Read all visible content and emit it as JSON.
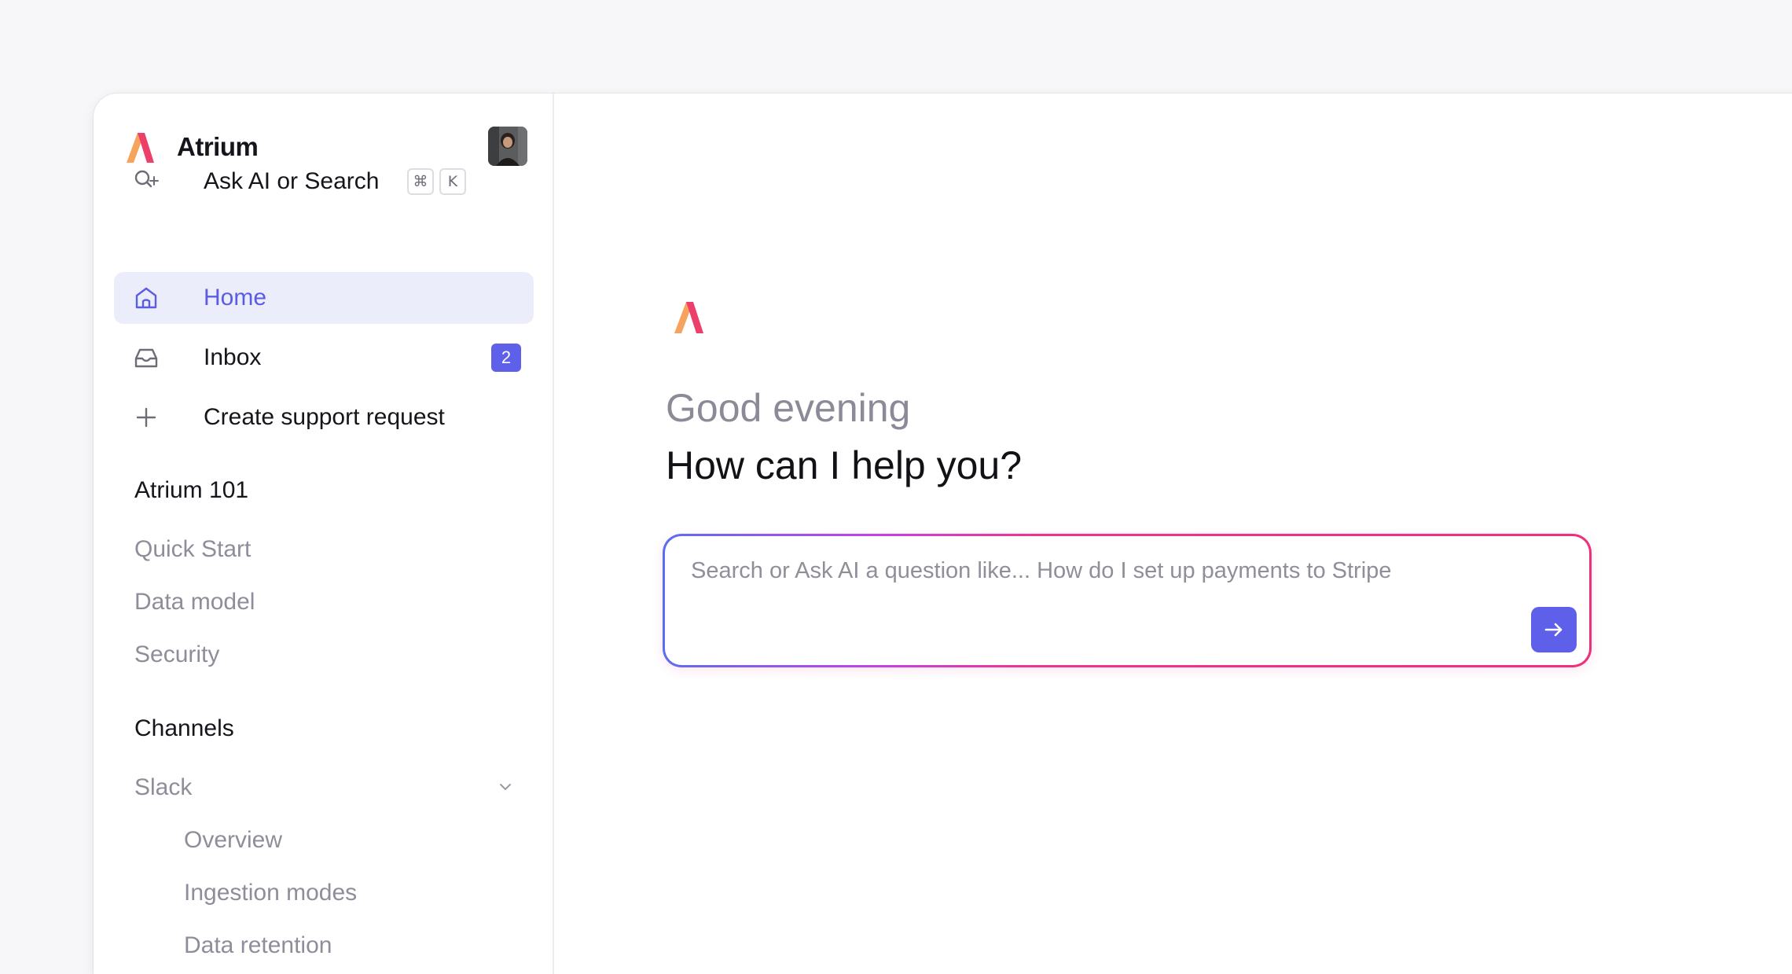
{
  "brand": {
    "name": "Atrium",
    "logo_colors": [
      "#f6a45d",
      "#ec3f6a"
    ]
  },
  "colors": {
    "accent": "#5e60ea",
    "active_bg": "#ecedfb",
    "gradient": [
      "#5b6ef0",
      "#c043e8",
      "#f0338f",
      "#ee2f7c"
    ]
  },
  "search_nav": {
    "label": "Ask AI or Search",
    "icon": "search-sparkle-icon",
    "shortcut": [
      "⌘",
      "K"
    ]
  },
  "nav": {
    "items": [
      {
        "label": "Home",
        "icon": "home-icon",
        "active": true
      },
      {
        "label": "Inbox",
        "icon": "inbox-icon",
        "badge": "2"
      },
      {
        "label": "Create support request",
        "icon": "plus-icon"
      }
    ]
  },
  "sections": [
    {
      "title": "Atrium 101",
      "links": [
        "Quick Start",
        "Data model",
        "Security"
      ]
    },
    {
      "title": "Channels",
      "groups": [
        {
          "label": "Slack",
          "expanded": true,
          "children": [
            "Overview",
            "Ingestion modes",
            "Data retention"
          ]
        }
      ]
    }
  ],
  "main": {
    "greeting": "Good evening",
    "question": "How can I help you?",
    "search": {
      "placeholder": "Search or Ask AI a question like... How do I set up payments to Stripe",
      "value": ""
    }
  }
}
